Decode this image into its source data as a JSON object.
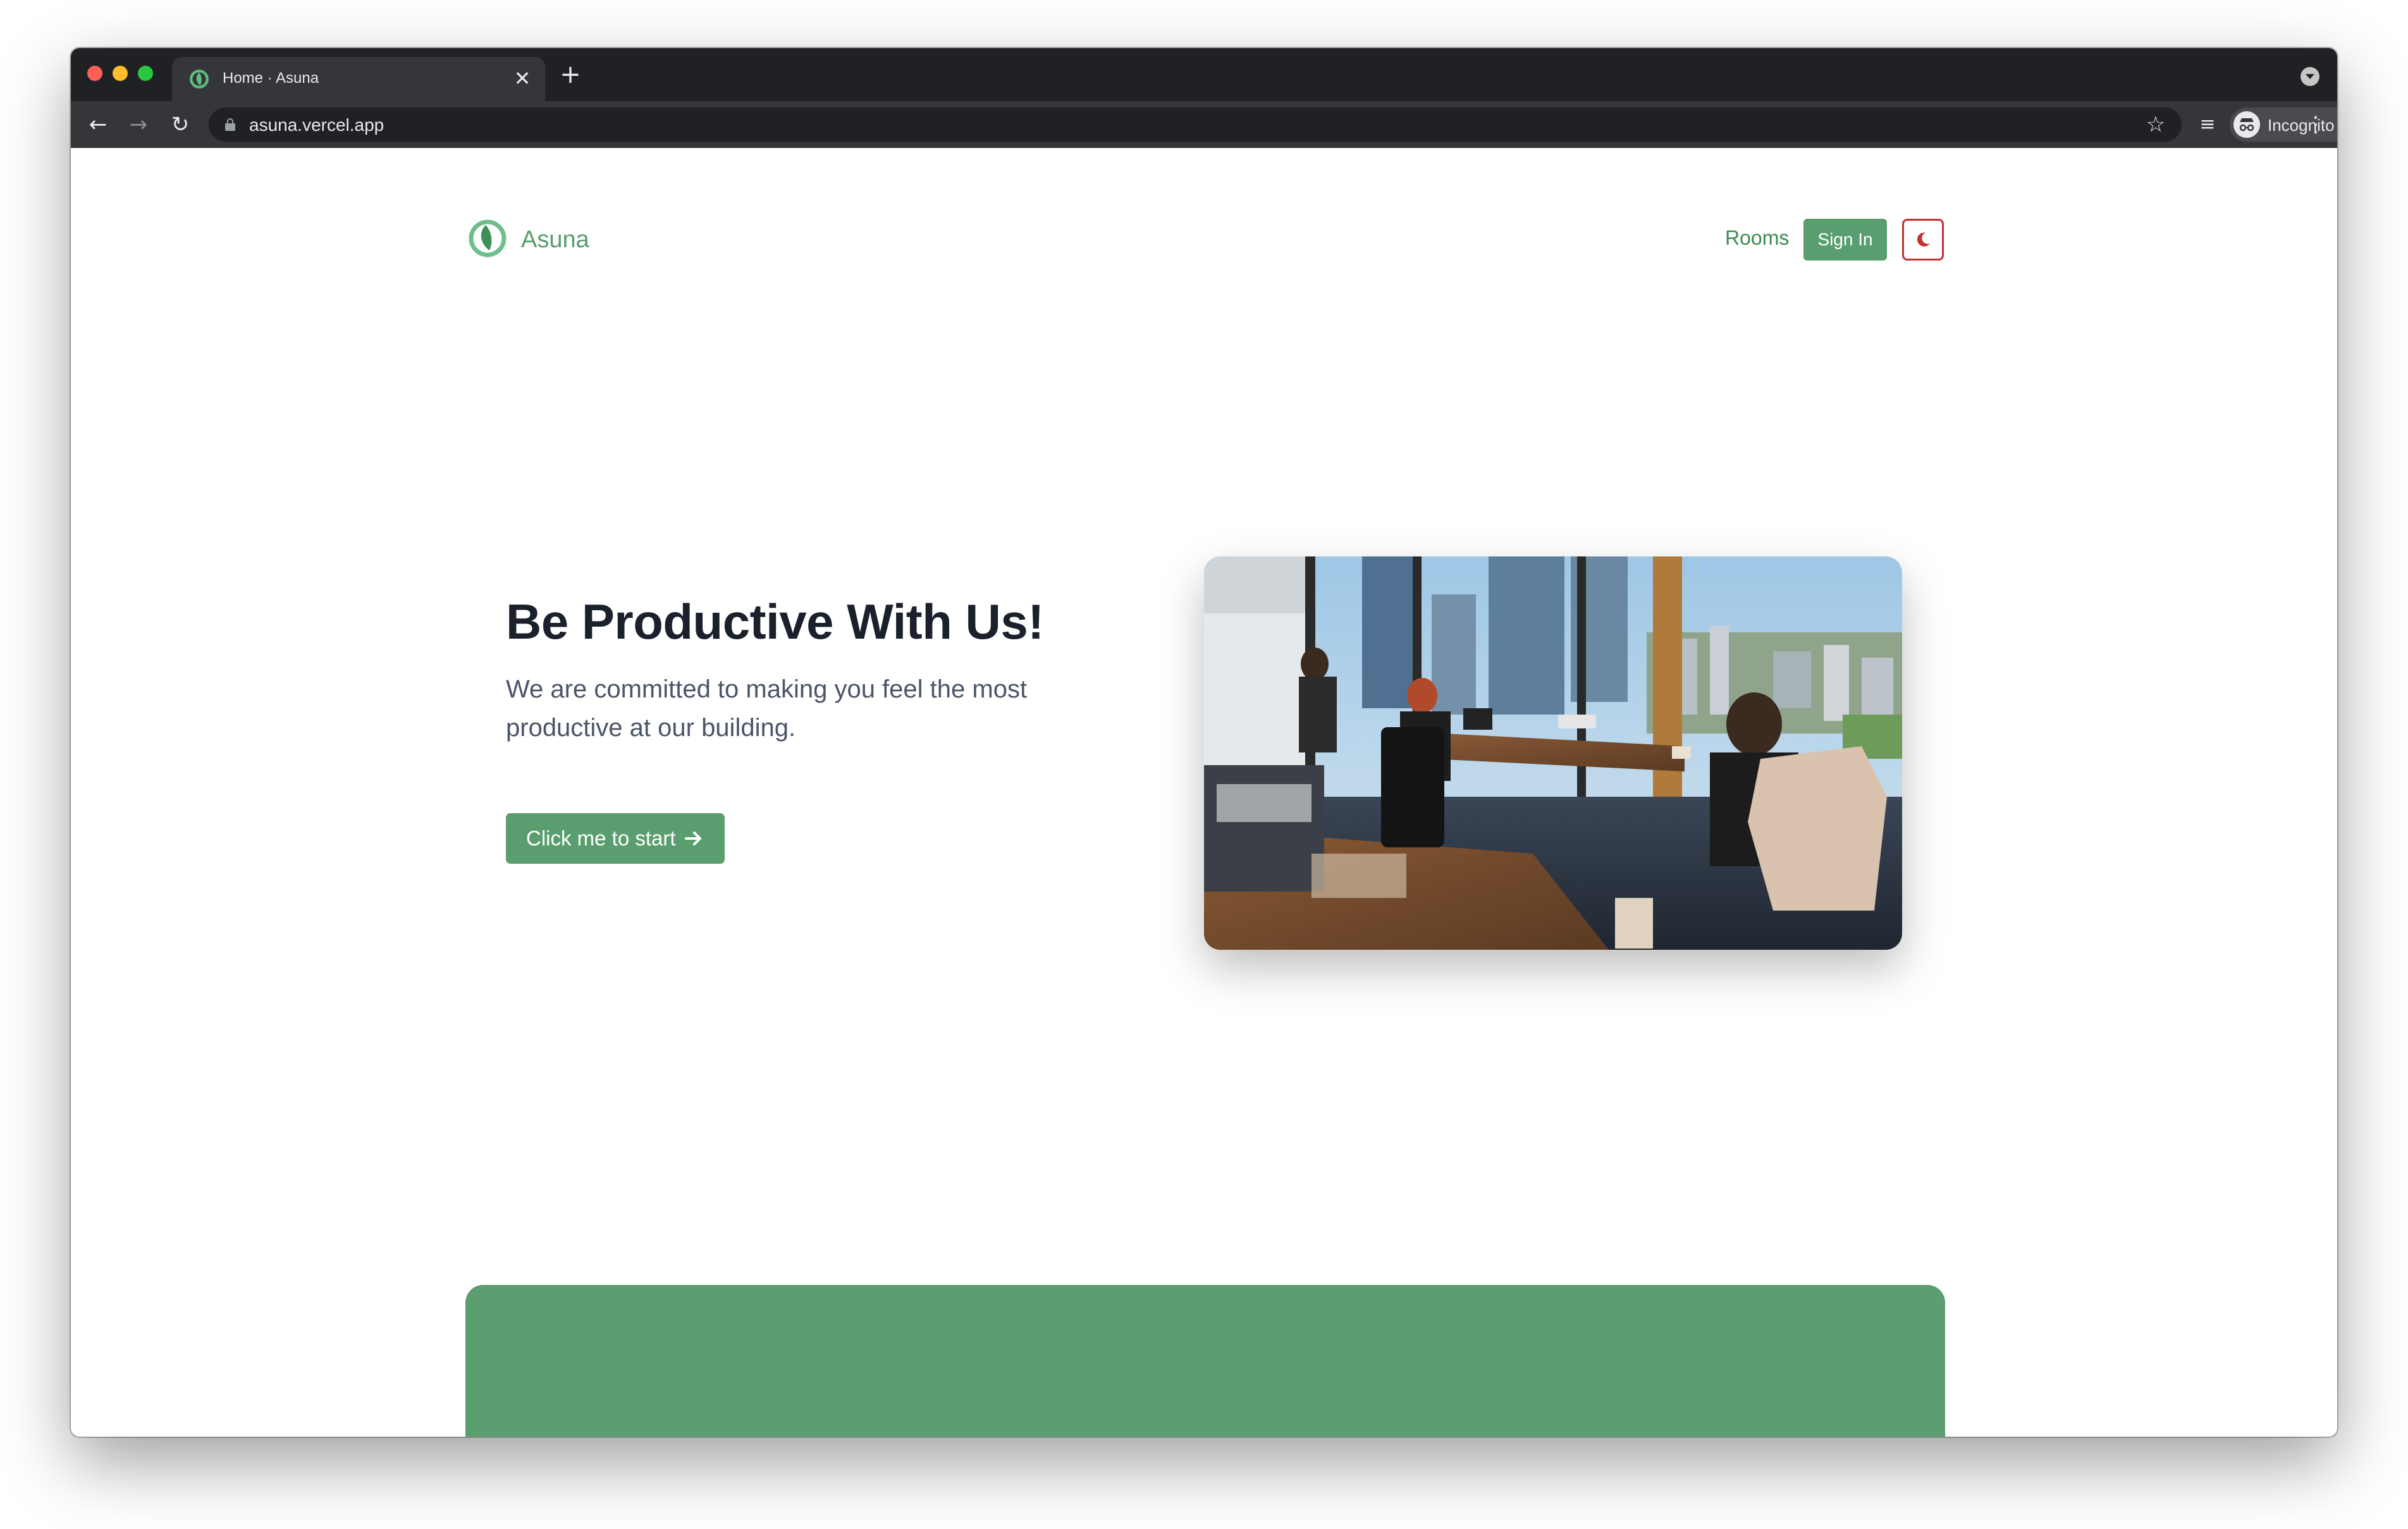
{
  "browser": {
    "tab_title": "Home · Asuna",
    "tab_close_glyph": "✕",
    "new_tab_glyph": "+",
    "url": "asuna.vercel.app",
    "profile_label": "Incognito",
    "icons": {
      "back": "←",
      "forward": "→",
      "reload": "↻",
      "star": "☆",
      "media": "≡",
      "menu": "⋮"
    }
  },
  "site": {
    "brand_name": "Asuna",
    "brand_color": "#579e6a",
    "nav": {
      "rooms_label": "Rooms",
      "signin_label": "Sign In"
    },
    "theme_toggle_icon": "moon-icon",
    "hero": {
      "title": "Be Productive With Us!",
      "subtitle": "We are committed to making you feel the most productive at our building.",
      "cta_label": "Click me to start"
    },
    "colors": {
      "primary": "#5a9e6f",
      "danger": "#c53030",
      "heading": "#1a202c",
      "body_text": "#4a5568"
    }
  }
}
